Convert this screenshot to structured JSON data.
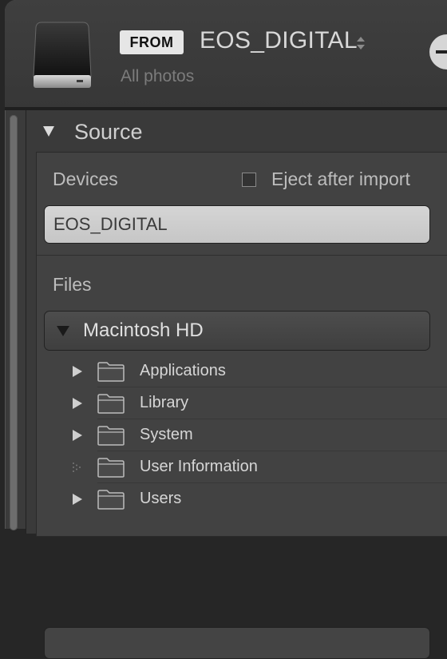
{
  "header": {
    "from_badge": "FROM",
    "source_name": "EOS_DIGITAL",
    "subtitle": "All photos"
  },
  "source_panel": {
    "title": "Source",
    "devices_label": "Devices",
    "eject_label": "Eject after import",
    "eject_checked": false,
    "device_selected": "EOS_DIGITAL",
    "files_label": "Files",
    "volume_label": "Macintosh HD",
    "folders": [
      {
        "name": "Applications",
        "expandable": true
      },
      {
        "name": "Library",
        "expandable": true
      },
      {
        "name": "System",
        "expandable": true
      },
      {
        "name": "User Information",
        "expandable": false
      },
      {
        "name": "Users",
        "expandable": true
      }
    ]
  },
  "colors": {
    "background": "#3b3b3b",
    "selected_item": "#d0d0d0",
    "text": "#c9c9c9"
  },
  "icons": [
    "hard-drive-icon",
    "updown-arrows-icon",
    "triangle-down-icon",
    "triangle-right-icon",
    "folder-icon"
  ]
}
